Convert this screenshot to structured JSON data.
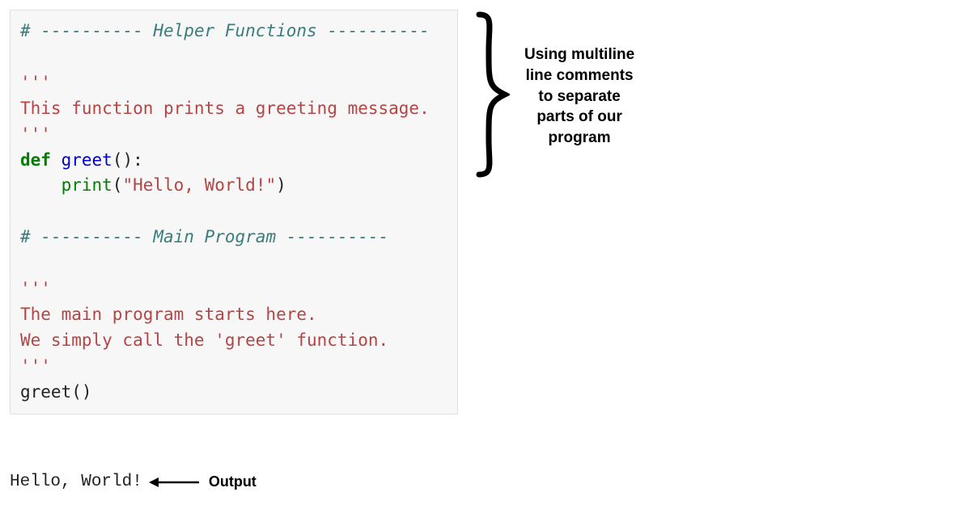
{
  "code": {
    "line1_hash": "# ",
    "line1_dash_pre": "---------- ",
    "line1_title": "Helper Functions",
    "line1_dash_post": " ----------",
    "triple_quote": "'''",
    "docstring1": "This function prints a greeting message.",
    "def_kw": "def",
    "space": " ",
    "funcname": "greet",
    "def_parens": "():",
    "indent": "    ",
    "print_name": "print",
    "open_paren": "(",
    "print_arg": "\"Hello, World!\"",
    "close_paren": ")",
    "line2_hash": "# ",
    "line2_dash_pre": "---------- ",
    "line2_title": "Main Program",
    "line2_dash_post": " ----------",
    "docstring2_l1": "The main program starts here.",
    "docstring2_l2": "We simply call the 'greet' function.",
    "call_name": "greet",
    "call_parens": "()"
  },
  "output": {
    "text": "Hello, World!",
    "label": "Output"
  },
  "annotation": {
    "line1": "Using multiline",
    "line2": "line comments",
    "line3": "to separate",
    "line4": "parts of our",
    "line5": "program"
  }
}
